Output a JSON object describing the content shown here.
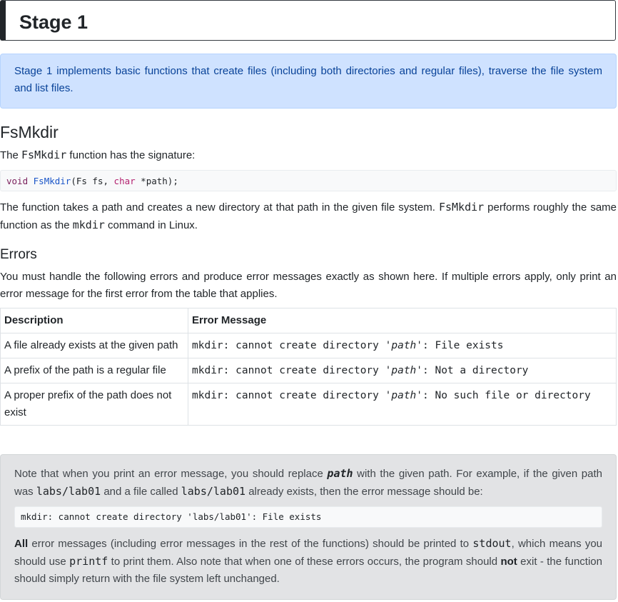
{
  "stage": {
    "title": "Stage 1"
  },
  "intro": {
    "text": "Stage 1 implements basic functions that create files (including both directories and regular files), traverse the file system and list files."
  },
  "section": {
    "heading": "FsMkdir",
    "signature_intro_pre": "The ",
    "signature_intro_code": "FsMkdir",
    "signature_intro_post": " function has the signature:",
    "signature": {
      "ret": "void",
      "name": "FsMkdir",
      "open": "(Fs fs, ",
      "type": "char",
      "rest": " *path);"
    },
    "desc_pre": "The function takes a path and creates a new directory at that path in the given file system. ",
    "desc_code1": "FsMkdir",
    "desc_mid": " performs roughly the same function as the ",
    "desc_code2": "mkdir",
    "desc_post": " command in Linux."
  },
  "errors": {
    "heading": "Errors",
    "intro": "You must handle the following errors and produce error messages exactly as shown here. If multiple errors apply, only print an error message for the first error from the table that applies.",
    "columns": [
      "Description",
      "Error Message"
    ],
    "rows": [
      {
        "description": "A file already exists at the given path",
        "msg_pre": "mkdir: cannot create directory '",
        "msg_path": "path",
        "msg_post": "': File exists"
      },
      {
        "description": "A prefix of the path is a regular file",
        "msg_pre": "mkdir: cannot create directory '",
        "msg_path": "path",
        "msg_post": "': Not a directory"
      },
      {
        "description": "A proper prefix of the path does not exist",
        "msg_pre": "mkdir: cannot create directory '",
        "msg_path": "path",
        "msg_post": "': No such file or directory"
      }
    ]
  },
  "note": {
    "p1_a": "Note that when you print an error message, you should replace ",
    "p1_path": "path",
    "p1_b": " with the given path. For example, if the given path was ",
    "p1_code1": "labs/lab01",
    "p1_c": " and a file called ",
    "p1_code2": "labs/lab01",
    "p1_d": " already exists, then the error message should be:",
    "example": "mkdir: cannot create directory 'labs/lab01': File exists",
    "p2_bold": "All",
    "p2_a": " error messages (including error messages in the rest of the functions) should be printed to ",
    "p2_code1": "stdout",
    "p2_b": ", which means you should use ",
    "p2_code2": "printf",
    "p2_c": " to print them. Also note that when one of these errors occurs, the program should ",
    "p2_bold2": "not",
    "p2_d": " exit - the function should simply return with the file system left unchanged."
  }
}
